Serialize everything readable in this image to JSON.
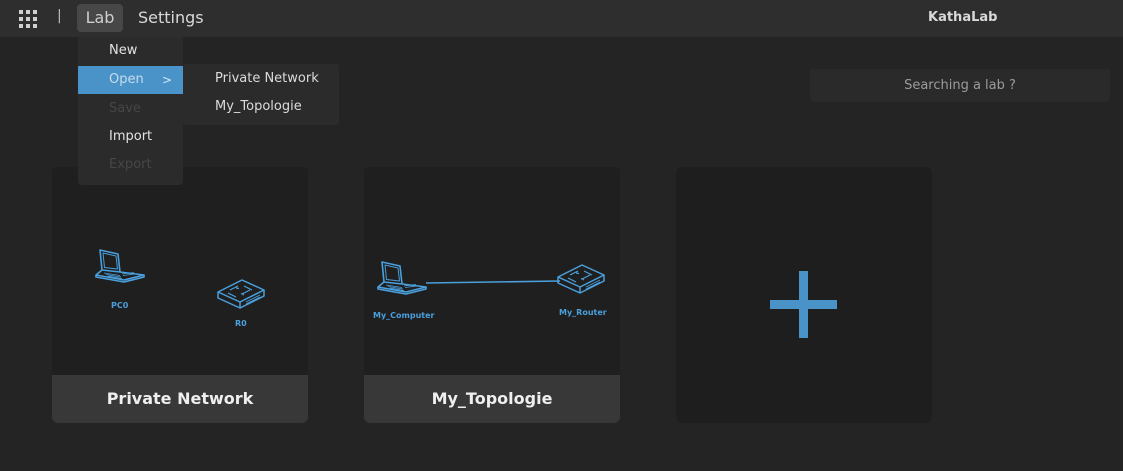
{
  "topbar": {
    "apps_icon": "grid-icon",
    "separator": "|",
    "menu_lab": "Lab",
    "menu_settings": "Settings",
    "app_title": "KathaLab"
  },
  "lab_menu": {
    "items": [
      {
        "label": "New",
        "state": "enabled"
      },
      {
        "label": "Open",
        "state": "highlighted",
        "has_submenu": true
      },
      {
        "label": "Save",
        "state": "disabled"
      },
      {
        "label": "Import",
        "state": "enabled"
      },
      {
        "label": "Export",
        "state": "disabled"
      }
    ],
    "submenu_chevron": ">",
    "open_submenu": [
      "Private Network",
      "My_Topologie"
    ]
  },
  "search": {
    "placeholder": "Searching a lab ?"
  },
  "labs": [
    {
      "title": "Private Network",
      "nodes": [
        {
          "label": "PC0",
          "icon": "laptop-icon"
        },
        {
          "label": "R0",
          "icon": "router-icon"
        }
      ]
    },
    {
      "title": "My_Topologie",
      "nodes": [
        {
          "label": "My_Computer",
          "icon": "laptop-icon"
        },
        {
          "label": "My_Router",
          "icon": "router-icon"
        }
      ]
    }
  ],
  "add_card": {
    "icon": "plus-icon"
  },
  "colors": {
    "accent": "#4a9fdc",
    "menu_highlight": "#4a93c9",
    "background": "#242424",
    "topbar": "#2e2e2e"
  }
}
